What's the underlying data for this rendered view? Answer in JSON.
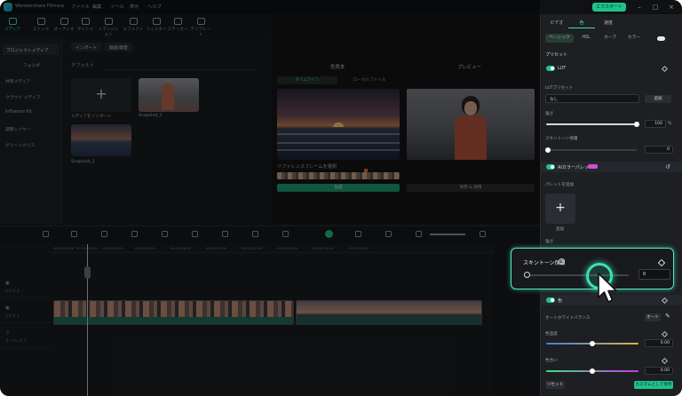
{
  "app": {
    "title": "Wondershare Filmora",
    "menu": [
      "ファイル",
      "編集",
      "ツール",
      "表示",
      "ヘルプ"
    ],
    "export_label": "エクスポート"
  },
  "toolbar": {
    "items": [
      {
        "label": "メディア",
        "icon": "media-icon"
      },
      {
        "label": "ストック",
        "icon": "stock-icon"
      },
      {
        "label": "オーディオ",
        "icon": "music-icon"
      },
      {
        "label": "タイトル",
        "icon": "title-icon"
      },
      {
        "label": "トランジション",
        "icon": "transition-icon"
      },
      {
        "label": "エフェクト",
        "icon": "effect-icon"
      },
      {
        "label": "フィルター",
        "icon": "filter-icon"
      },
      {
        "label": "ステッカー",
        "icon": "sticker-icon"
      },
      {
        "label": "テンプレート",
        "icon": "template-icon"
      }
    ]
  },
  "left_panel": {
    "project_media": "プロジェクトメディア",
    "items": [
      "フォルダ",
      "共有メディア",
      "クラウド メディア",
      "Influence Kit",
      "調整レイヤー",
      "グリーンクリス"
    ]
  },
  "media": {
    "import_label": "インポート",
    "record_label": "録画/録音",
    "sort_label": "デフォルト",
    "import_card_label": "メディアをインポート",
    "thumbs": [
      "Snapshot_1",
      "Snapshot_2"
    ]
  },
  "preview": {
    "left_title": "色見本",
    "right_title": "プレビュー",
    "tabs": [
      "タイムライン",
      "ローカルファイル"
    ],
    "frame_label": "リファレンスフレームを選択",
    "apply_label": "生成",
    "save_label": "保存 & 適用"
  },
  "timeline": {
    "ticks": [
      "00:00:00:00",
      "00:00:02:00",
      "00:00:04:00",
      "00:00:06:00",
      "00:00:08:00",
      "00:00:10:00",
      "00:00:12:00",
      "00:00:14:00",
      "00:00:16:00",
      "00:00:18:00"
    ],
    "tracks": [
      "ビデオ 2",
      "ビデオ 1",
      "オーディオ 1"
    ],
    "playhead_time": "00:00:02:00"
  },
  "right_panel": {
    "tabs": [
      "ビデオ",
      "色",
      "速度"
    ],
    "subtabs": [
      "ベーシック",
      "HSL",
      "カーブ",
      "カラー"
    ],
    "preset_label": "プリセット",
    "lut_label": "LUT",
    "lut_preset_label": "LUTプリセット",
    "lut_value": "なし",
    "add_label": "追加",
    "strength_label": "強さ",
    "strength_value": "100",
    "strength_unit": "%",
    "skin_label": "スキントーン保護",
    "skin_value": "0",
    "ai_palette_label": "AIカラーパレット",
    "palette_add_label": "パレットを追加",
    "card_label": "追加",
    "strength2_label": "強さ",
    "color_label": "色",
    "wb_label": "オートホワイトバランス",
    "auto_label": "オート",
    "temp_label": "色温度",
    "temp_value": "0.00",
    "tint_label": "色合い",
    "tint_value": "0.00",
    "reset_label": "リセット",
    "save_custom_label": "カスタムとして保存"
  },
  "highlight": {
    "label": "スキントーン保護",
    "value": "0"
  },
  "colors": {
    "accent": "#3de0b4",
    "export": "#1ec38a",
    "panel": "#1d1f22"
  }
}
